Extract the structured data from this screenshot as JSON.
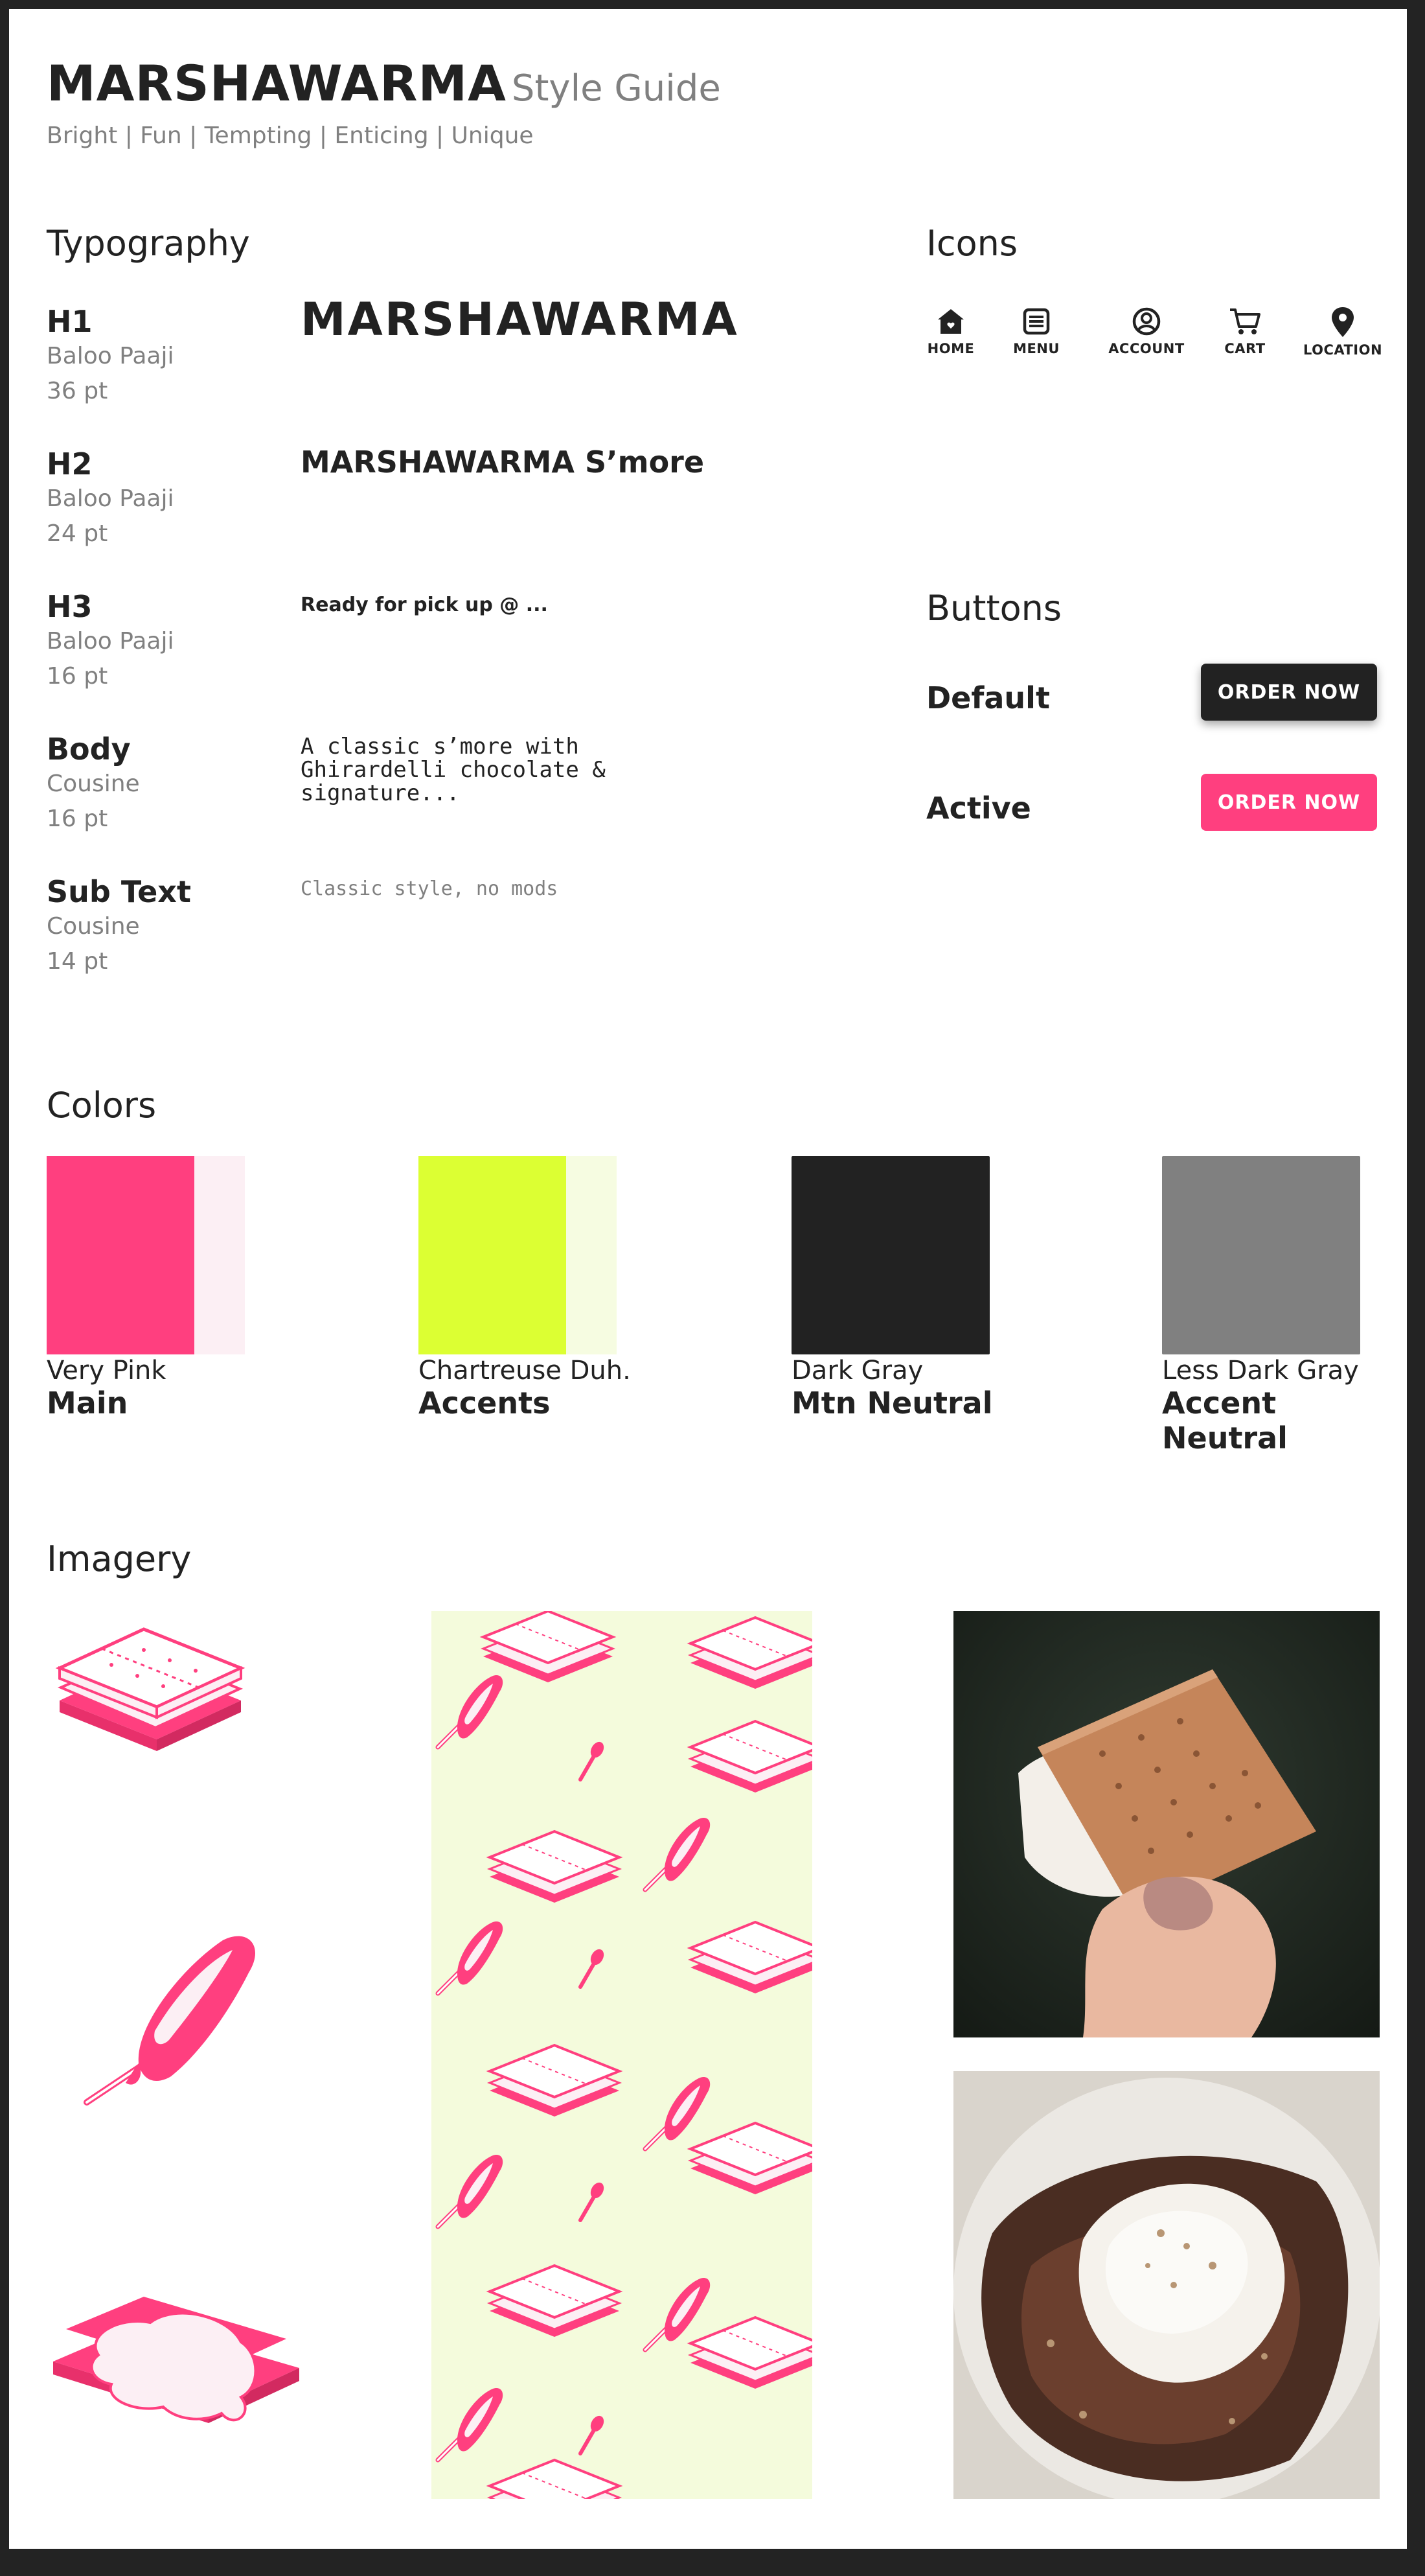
{
  "header": {
    "brand": "MARSHAWARMA",
    "subtitle": "Style Guide",
    "tagline": "Bright | Fun | Tempting | Enticing | Unique"
  },
  "typography": {
    "title": "Typography",
    "styles": [
      {
        "name": "H1",
        "font": "Baloo Paaji",
        "size": "36 pt",
        "sample": "MARSHAWARMA"
      },
      {
        "name": "H2",
        "font": "Baloo Paaji",
        "size": "24 pt",
        "sample": "MARSHAWARMA S’more"
      },
      {
        "name": "H3",
        "font": "Baloo Paaji",
        "size": "16 pt",
        "sample": "Ready for pick up @ ..."
      },
      {
        "name": "Body",
        "font": "Cousine",
        "size": "16 pt",
        "sample": "A classic s’more with\nGhirardelli chocolate &\nsignature..."
      },
      {
        "name": "Sub Text",
        "font": "Cousine",
        "size": "14 pt",
        "sample": "Classic style, no mods"
      }
    ]
  },
  "icons": {
    "title": "Icons",
    "items": [
      {
        "label": "HOME",
        "icon": "home-icon"
      },
      {
        "label": "MENU",
        "icon": "menu-icon"
      },
      {
        "label": "ACCOUNT",
        "icon": "account-icon"
      },
      {
        "label": "CART",
        "icon": "cart-icon"
      },
      {
        "label": "LOCATION",
        "icon": "location-icon"
      }
    ]
  },
  "buttons": {
    "title": "Buttons",
    "default": {
      "label": "Default",
      "button_text": "ORDER NOW",
      "color": "#222222"
    },
    "active": {
      "label": "Active",
      "button_text": "ORDER NOW",
      "color": "#FF3F7F"
    }
  },
  "colors": {
    "title": "Colors",
    "swatches": [
      {
        "name": "Very Pink",
        "role": "Main",
        "color": "#FF3F7F",
        "tint": "#FCEFF4"
      },
      {
        "name": "Chartreuse Duh.",
        "role": "Accents",
        "color": "#DCFF33",
        "tint": "#F6FCE1"
      },
      {
        "name": "Dark Gray",
        "role": "Mtn Neutral",
        "color": "#222222"
      },
      {
        "name": "Less Dark Gray",
        "role": "Accent Neutral",
        "color": "#808080"
      }
    ]
  },
  "imagery": {
    "title": "Imagery",
    "illustrations": [
      "smore-illustration",
      "melting-marshmallow-illustration",
      "melted-smore-illustration"
    ],
    "pattern": "smore-pattern",
    "photos": [
      "smore-hand-photo",
      "smore-dessert-plate-photo"
    ]
  }
}
